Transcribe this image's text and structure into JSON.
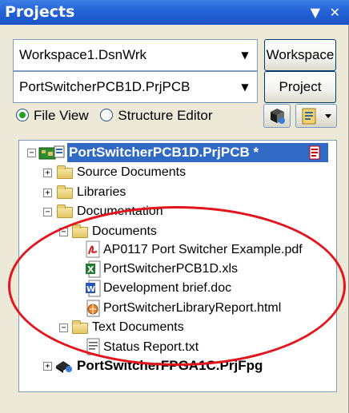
{
  "panel": {
    "title": "Projects",
    "controls": "▼ ✕"
  },
  "workspace_combo": {
    "value": "Workspace1.DsnWrk"
  },
  "project_combo": {
    "value": "PortSwitcherPCB1D.PrjPCB"
  },
  "buttons": {
    "workspace": "Workspace",
    "project": "Project"
  },
  "view_mode": {
    "options": [
      {
        "label": "File View",
        "selected": true
      },
      {
        "label": "Structure Editor",
        "selected": false
      }
    ]
  },
  "tree": {
    "root_project": {
      "label": "PortSwitcherPCB1D.PrjPCB *",
      "expander": "−",
      "selected": true
    },
    "source_documents": {
      "label": "Source Documents",
      "expander": "+"
    },
    "libraries": {
      "label": "Libraries",
      "expander": "+"
    },
    "documentation": {
      "label": "Documentation",
      "expander": "−"
    },
    "documents": {
      "label": "Documents",
      "expander": "−"
    },
    "files": [
      {
        "label": "AP0117 Port Switcher Example.pdf",
        "icon": "pdf-icon"
      },
      {
        "label": "PortSwitcherPCB1D.xls",
        "icon": "excel-icon"
      },
      {
        "label": "Development brief.doc",
        "icon": "word-icon"
      },
      {
        "label": "PortSwitcherLibraryReport.html",
        "icon": "html-icon"
      }
    ],
    "text_documents": {
      "label": "Text Documents",
      "expander": "−"
    },
    "text_file": {
      "label": "Status Report.txt",
      "icon": "text-file-icon"
    },
    "fpga_project": {
      "label": "PortSwitcherFPGA1C.PrjFpg",
      "expander": "+"
    }
  },
  "colors": {
    "title_bar": "#2563d6",
    "selection": "#316ac5",
    "highlight_oval": "#e3141b"
  }
}
